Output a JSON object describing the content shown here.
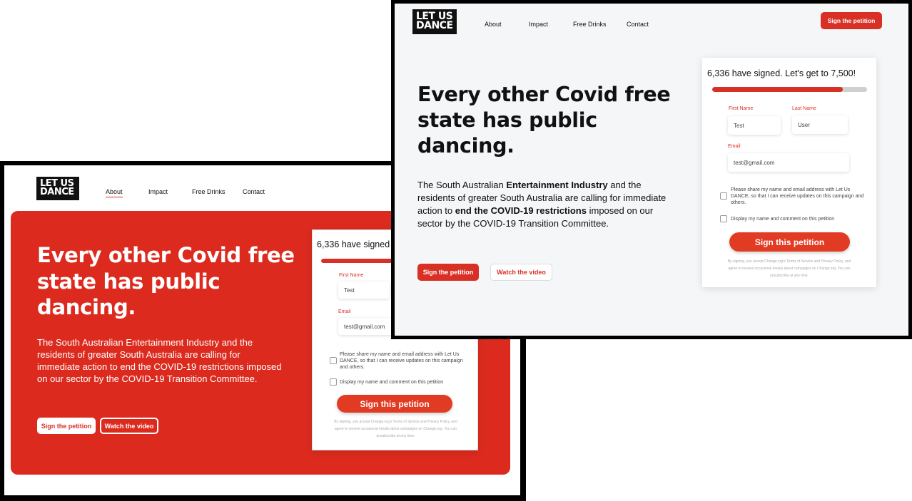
{
  "brand": {
    "logo_line1": "LET US",
    "logo_line2": "DANCE"
  },
  "nav": {
    "items": [
      "About",
      "Impact",
      "Free Drinks",
      "Contact"
    ],
    "cta": "Sign the petition"
  },
  "hero": {
    "title_line1": "Every other Covid free",
    "title_line2": "state has public",
    "title_line3": "dancing.",
    "back_text": "The South Australian Entertainment Industry and the residents of greater South Australia are calling for immediate action to end the COVID-19 restrictions imposed on our sector by the COVID-19 Transition Committee.",
    "front_text_1": "The South Australian ",
    "front_text_bold_1": "Entertainment Industry",
    "front_text_2": " and the residents of greater South Australia are calling for immediate action to ",
    "front_text_bold_2": "end the COVID-19 restrictions",
    "front_text_3": " imposed on our sector by the COVID-19 Transition Committee.",
    "primary_button": "Sign the petition",
    "secondary_button": "Watch the video"
  },
  "petition": {
    "signed_text_front": "6,336 have signed. Let's get to 7,500!",
    "signed_text_back": "6,336 have signed",
    "progress_fraction": 0.845,
    "first_name_label": "First Name",
    "first_name_value": "Test",
    "last_name_label": "Last Name",
    "last_name_value": "User",
    "email_label": "Email",
    "email_value": "test@gmail.com",
    "share_checkbox_label": "Please share my name and email address with Let Us DANCE, so that I can receive updates on this campaign and others.",
    "display_checkbox_label": "Display my name and comment on this petition",
    "submit_label": "Sign this petition",
    "legal_line1": "By signing, you accept Change.org's Terms of Service and Privacy Policy, and",
    "legal_line2": "agree to receive occasional emails about campaigns on Change.org. You can",
    "legal_line3": "unsubscribe at any time."
  },
  "colors": {
    "brand_red": "#dc2b1e",
    "button_red": "#d93026",
    "front_background": "#f5f6f8"
  }
}
